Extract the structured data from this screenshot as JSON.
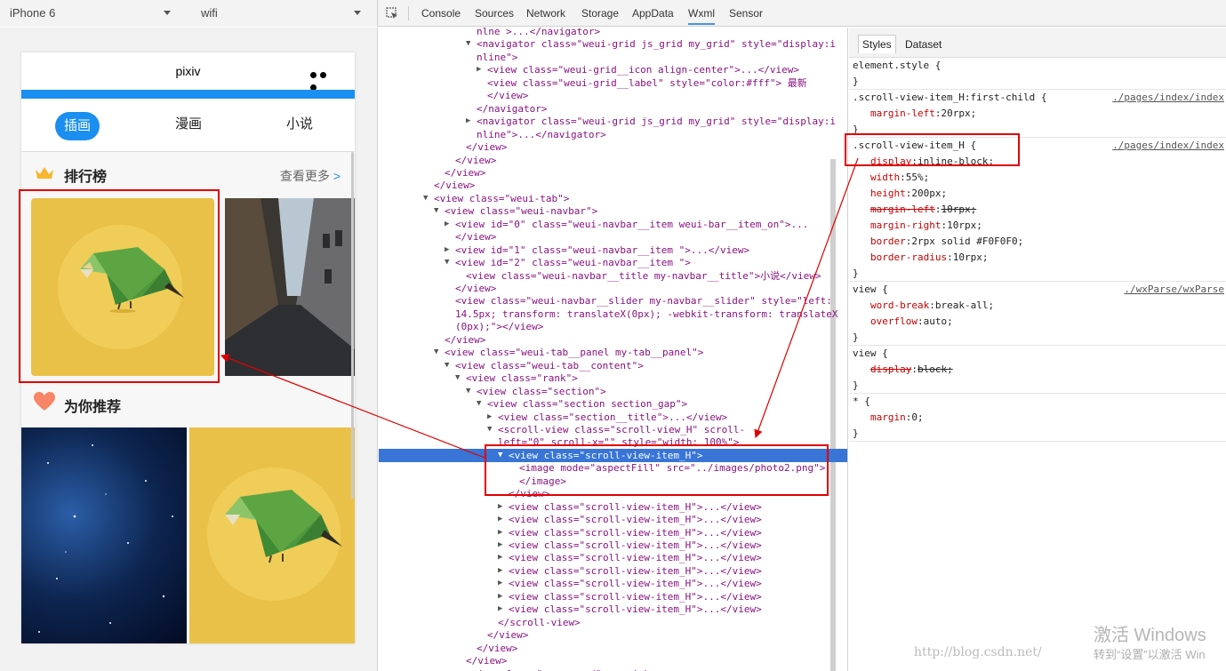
{
  "toolbar": {
    "device": "iPhone 6",
    "network": "wifi",
    "tabs": [
      "Console",
      "Sources",
      "Network",
      "Storage",
      "AppData",
      "Wxml",
      "Sensor"
    ],
    "active_tab": "Wxml"
  },
  "phone": {
    "title": "pixiv",
    "nav": [
      "插画",
      "漫画",
      "小说"
    ],
    "section1_title": "排行榜",
    "more_label": "查看更多",
    "more_arrow": ">",
    "section2_title": "为你推荐"
  },
  "wxml_lines": [
    {
      "t": "nlne >...</navigator>",
      "indent": 0,
      "tw": ""
    },
    {
      "t": "<navigator class=\"weui-grid js_grid my_grid\" style=\"display:i",
      "indent": 0,
      "tw": "▼"
    },
    {
      "t": "nline\">",
      "indent": 0,
      "tw": ""
    },
    {
      "t": "<view class=\"weui-grid__icon align-center\">...</view>",
      "indent": 1,
      "tw": "▶"
    },
    {
      "t": "<view class=\"weui-grid__label\" style=\"color:#fff\"> 最新",
      "indent": 1,
      "tw": ""
    },
    {
      "t": "</view>",
      "indent": 1,
      "tw": ""
    },
    {
      "t": "</navigator>",
      "indent": 0,
      "tw": ""
    },
    {
      "t": "<navigator class=\"weui-grid js_grid my_grid\" style=\"display:i",
      "indent": 0,
      "tw": "▶"
    },
    {
      "t": "nline\">...</navigator>",
      "indent": 0,
      "tw": ""
    },
    {
      "t": "</view>",
      "indent": -1,
      "tw": ""
    },
    {
      "t": "</view>",
      "indent": -2,
      "tw": ""
    },
    {
      "t": "</view>",
      "indent": -3,
      "tw": ""
    },
    {
      "t": "</view>",
      "indent": -4,
      "tw": ""
    },
    {
      "t": "<view class=\"weui-tab\">",
      "indent": -4,
      "tw": "▼"
    },
    {
      "t": "<view class=\"weui-navbar\">",
      "indent": -3,
      "tw": "▼"
    },
    {
      "t": "<view id=\"0\" class=\"weui-navbar__item weui-bar__item_on\">...",
      "indent": -2,
      "tw": "▶"
    },
    {
      "t": "</view>",
      "indent": -2,
      "tw": ""
    },
    {
      "t": "<view id=\"1\" class=\"weui-navbar__item \">...</view>",
      "indent": -2,
      "tw": "▶"
    },
    {
      "t": "<view id=\"2\" class=\"weui-navbar__item \">",
      "indent": -2,
      "tw": "▼"
    },
    {
      "t": "<view class=\"weui-navbar__title my-navbar__title\">小说</view>",
      "indent": -1,
      "tw": ""
    },
    {
      "t": "</view>",
      "indent": -2,
      "tw": ""
    },
    {
      "t": "<view class=\"weui-navbar__slider my-navbar__slider\" style=\"left:",
      "indent": -2,
      "tw": ""
    },
    {
      "t": "14.5px; transform: translateX(0px); -webkit-transform: translateX",
      "indent": -2,
      "tw": ""
    },
    {
      "t": "(0px);\"></view>",
      "indent": -2,
      "tw": ""
    },
    {
      "t": "</view>",
      "indent": -3,
      "tw": ""
    },
    {
      "t": "<view class=\"weui-tab__panel my-tab__panel\">",
      "indent": -3,
      "tw": "▼"
    },
    {
      "t": "<view class=\"weui-tab__content\">",
      "indent": -2,
      "tw": "▼"
    },
    {
      "t": "<view class=\"rank\">",
      "indent": -1,
      "tw": "▼"
    },
    {
      "t": "<view class=\"section\">",
      "indent": 0,
      "tw": "▼"
    },
    {
      "t": "<view class=\"section section_gap\">",
      "indent": 1,
      "tw": "▼"
    },
    {
      "t": "<view class=\"section__title\">...</view>",
      "indent": 2,
      "tw": "▶"
    },
    {
      "t": "<scroll-view class=\"scroll-view_H\" scroll-",
      "indent": 2,
      "tw": "▼"
    },
    {
      "t": "left=\"0\" scroll-x=\"\" style=\"width: 100%\">",
      "indent": 2,
      "tw": ""
    },
    {
      "t": "<view class=\"scroll-view-item_H\">",
      "indent": 3,
      "tw": "▼",
      "sel": true
    },
    {
      "t": "<image mode=\"aspectFill\" src=\"../images/photo2.png\">",
      "indent": 4,
      "tw": ""
    },
    {
      "t": "</image>",
      "indent": 4,
      "tw": ""
    },
    {
      "t": "</view>",
      "indent": 3,
      "tw": ""
    },
    {
      "t": "<view class=\"scroll-view-item_H\">...</view>",
      "indent": 3,
      "tw": "▶"
    },
    {
      "t": "<view class=\"scroll-view-item_H\">...</view>",
      "indent": 3,
      "tw": "▶"
    },
    {
      "t": "<view class=\"scroll-view-item_H\">...</view>",
      "indent": 3,
      "tw": "▶"
    },
    {
      "t": "<view class=\"scroll-view-item_H\">...</view>",
      "indent": 3,
      "tw": "▶"
    },
    {
      "t": "<view class=\"scroll-view-item_H\">...</view>",
      "indent": 3,
      "tw": "▶"
    },
    {
      "t": "<view class=\"scroll-view-item_H\">...</view>",
      "indent": 3,
      "tw": "▶"
    },
    {
      "t": "<view class=\"scroll-view-item_H\">...</view>",
      "indent": 3,
      "tw": "▶"
    },
    {
      "t": "<view class=\"scroll-view-item_H\">...</view>",
      "indent": 3,
      "tw": "▶"
    },
    {
      "t": "<view class=\"scroll-view-item_H\">...</view>",
      "indent": 3,
      "tw": "▶"
    },
    {
      "t": "</scroll-view>",
      "indent": 2,
      "tw": ""
    },
    {
      "t": "</view>",
      "indent": 1,
      "tw": ""
    },
    {
      "t": "</view>",
      "indent": 0,
      "tw": ""
    },
    {
      "t": "</view>",
      "indent": -1,
      "tw": ""
    },
    {
      "t": "<view class=\"recommend\">...</view>",
      "indent": -1,
      "tw": "▶"
    }
  ],
  "styles": {
    "tabs": [
      "Styles",
      "Dataset"
    ],
    "rules": [
      {
        "selector": "element.style {",
        "src": "",
        "props": []
      },
      {
        "selector": ".scroll-view-item_H:first-child {",
        "src": "./pages/index/index",
        "props": [
          {
            "n": "margin-left",
            "v": "20rpx;",
            "strike": false
          }
        ]
      },
      {
        "selector": ".scroll-view-item_H {",
        "src": "./pages/index/index",
        "props": [
          {
            "n": "display",
            "v": "inline-block;",
            "strike": false
          },
          {
            "n": "width",
            "v": "55%;",
            "strike": false
          },
          {
            "n": "height",
            "v": "200px;",
            "strike": false
          },
          {
            "n": "margin-left",
            "v": "10rpx;",
            "strike": true
          },
          {
            "n": "margin-right",
            "v": "10rpx;",
            "strike": false
          },
          {
            "n": "border",
            "v": "2rpx solid #F0F0F0;",
            "strike": false
          },
          {
            "n": "border-radius",
            "v": "10rpx;",
            "strike": false
          }
        ]
      },
      {
        "selector": "view {",
        "src": "./wxParse/wxParse",
        "props": [
          {
            "n": "word-break",
            "v": "break-all;",
            "strike": false
          },
          {
            "n": "overflow",
            "v": "auto;",
            "strike": false
          }
        ]
      },
      {
        "selector": "view {",
        "src": "",
        "props": [
          {
            "n": "display",
            "v": "block;",
            "strike": true
          }
        ]
      },
      {
        "selector": "* {",
        "src": "",
        "props": [
          {
            "n": "margin",
            "v": "0;",
            "strike": false
          }
        ]
      }
    ]
  },
  "watermark": {
    "line1": "激活 Windows",
    "line2": "转到“设置”以激活 Win",
    "url": "http://blog.csdn.net/"
  },
  "colors": {
    "accent": "#1a8ff0",
    "annotation": "#e00000",
    "selection": "#3875d7"
  }
}
